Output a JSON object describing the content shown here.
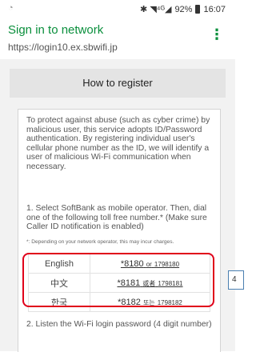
{
  "status_bar": {
    "left_icon": "wifi-question-icon",
    "signal_glyphs": "✱ ◥⁴ᴳ◢",
    "battery": "92%",
    "time": "16:07"
  },
  "app_bar": {
    "title": "Sign in to network",
    "url": "https://login10.ex.sbwifi.jp",
    "menu_glyph": "⋮"
  },
  "header": {
    "title": "How to register"
  },
  "content": {
    "intro": "To protect against abuse (such as cyber crime) by malicious user, this service adopts ID/Password authentication. By registering individual user's cellular phone number as the ID, we will identify a user of malicious Wi-Fi communication when necessary.",
    "step1": "1. Select SoftBank as mobile operator. Then, dial one of the following toll free number.* (Make sure Caller ID notification is enabled)",
    "note": "*: Depending on your network operator, this may incur charges.",
    "numbers": [
      {
        "language": "English",
        "primary": "*8180",
        "connector": "or",
        "alt": "1798180"
      },
      {
        "language": "中文",
        "primary": "*8181",
        "connector": "或者",
        "alt": "1798181"
      },
      {
        "language": "한국",
        "primary": "*8182",
        "connector": "또는",
        "alt": "1798182"
      }
    ],
    "step2": "2. Listen the Wi-Fi login password (4 digit number)"
  },
  "marker": {
    "label": "4"
  },
  "colors": {
    "accent_green": "#0a8f3c",
    "highlight_red": "#e0001a"
  }
}
